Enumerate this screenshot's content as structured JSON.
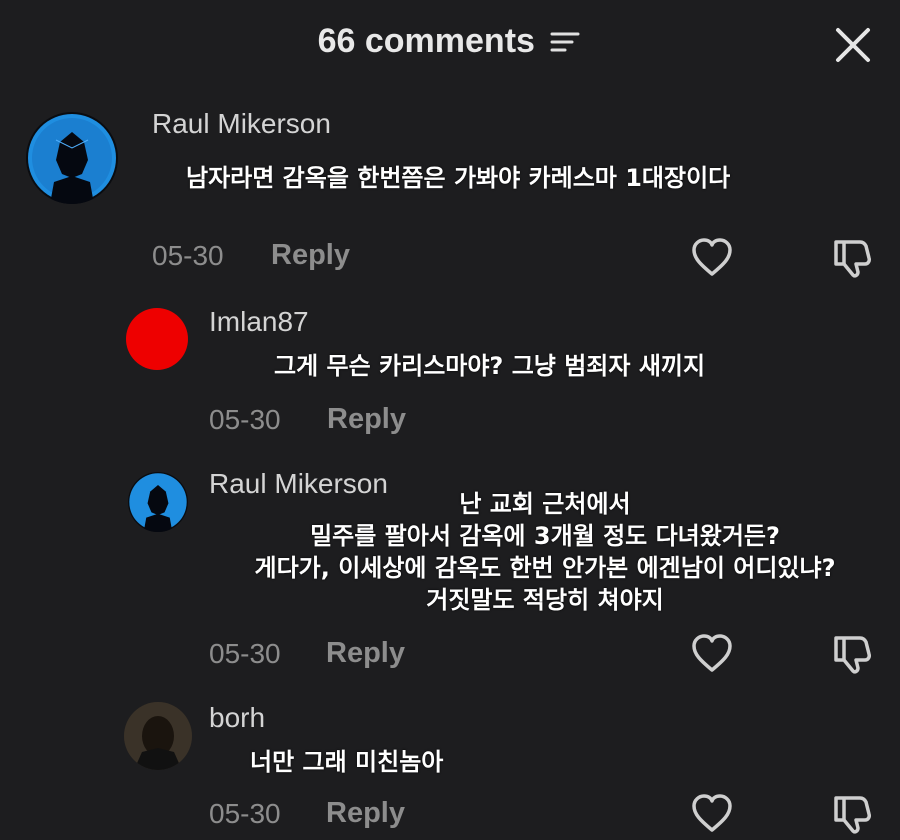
{
  "header": {
    "title": "66 comments"
  },
  "comments": [
    {
      "username": "Raul Mikerson",
      "text": "남자라면 감옥을 한번쯤은 가봐야 카레스마 1대장이다",
      "date": "05-30",
      "reply_label": "Reply"
    },
    {
      "username": "Imlan87",
      "text": "그게 무슨 카리스마야? 그냥 범죄자 새끼지",
      "date": "05-30",
      "reply_label": "Reply"
    },
    {
      "username": "Raul Mikerson",
      "text_lines": [
        "난 교회 근처에서",
        "밀주를 팔아서 감옥에 3개월 정도 다녀왔거든?",
        "게다가, 이세상에 감옥도 한번 안가본 에겐남이 어디있냐?",
        "거짓말도 적당히 쳐야지"
      ],
      "date": "05-30",
      "reply_label": "Reply"
    },
    {
      "username": "borh",
      "text": "너만 그래 미친놈아",
      "date": "05-30",
      "reply_label": "Reply"
    }
  ],
  "icons": {
    "filter": "filter-icon",
    "close": "close-icon",
    "like": "heart-icon",
    "dislike": "thumbs-down-icon"
  },
  "colors": {
    "background": "#1d1d1f",
    "text_primary": "#ffffff",
    "text_secondary": "#8d8d8d",
    "avatar_red": "#ee0000",
    "avatar_blue": "#1f8ee0"
  }
}
